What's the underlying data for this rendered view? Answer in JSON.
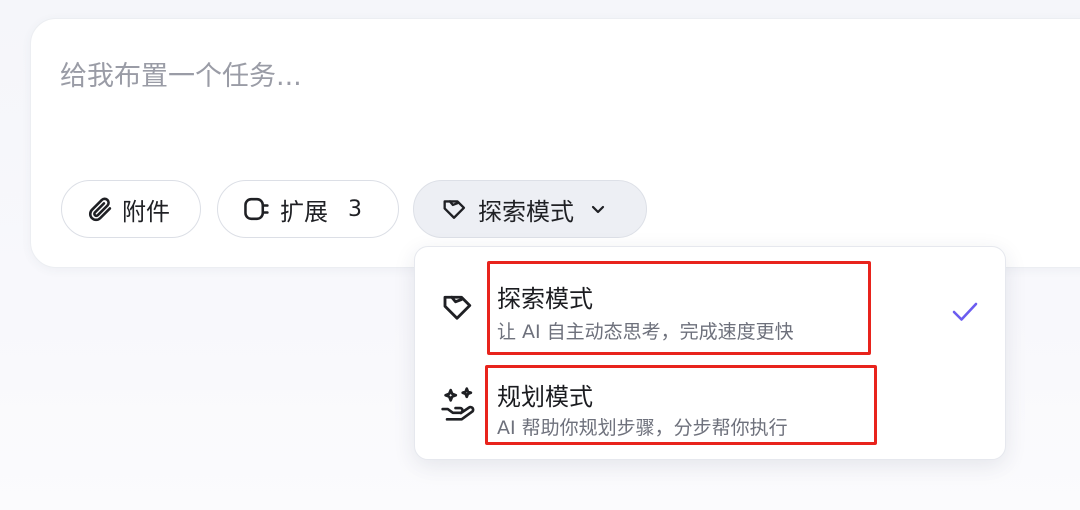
{
  "composer": {
    "placeholder": "给我布置一个任务..."
  },
  "toolbar": {
    "attach_label": "附件",
    "extensions_label": "扩展",
    "extensions_count": "3",
    "mode_label": "探索模式"
  },
  "mode_menu": {
    "items": [
      {
        "title": "探索模式",
        "description": "让 AI 自主动态思考，完成速度更快",
        "icon": "explore-tag-icon",
        "selected": true,
        "highlighted": true
      },
      {
        "title": "规划模式",
        "description": "AI 帮助你规划步骤，分步帮你执行",
        "icon": "plan-hand-sparkle-icon",
        "selected": false,
        "highlighted": true
      }
    ]
  },
  "colors": {
    "check": "#6b5cf0",
    "highlight_box": "#e8231c",
    "mode_pill_bg": "#edeff4"
  }
}
